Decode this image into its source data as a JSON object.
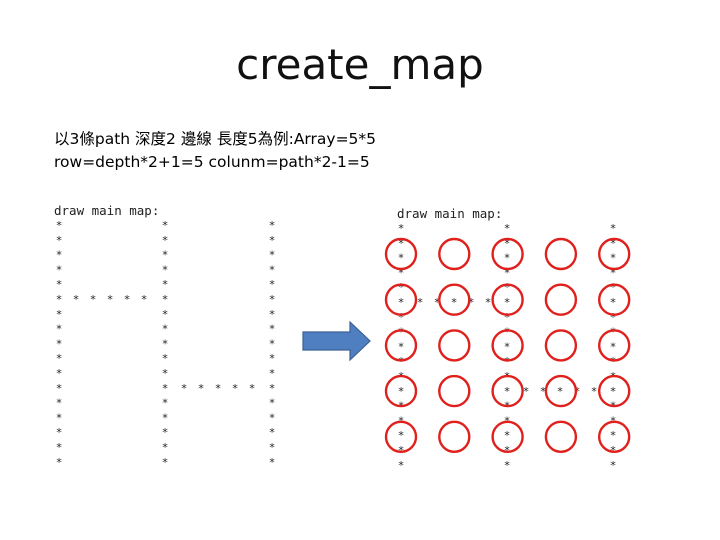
{
  "slide": {
    "title": "create_map",
    "description_line1": "以3條path 深度2 邊線 長度5為例:Array=5*5",
    "description_line2": "row=depth*2+1=5  colunm=path*2-1=5"
  },
  "left_map": {
    "title": "draw main map:",
    "rows": 17
  },
  "right_map": {
    "title": "draw main map:",
    "rows": 17,
    "grid_size": 5
  },
  "colors": {
    "arrow_fill": "#4f7fc0",
    "arrow_stroke": "#3a6296",
    "circle_stroke": "#e0201c"
  },
  "icons": {
    "arrow": "right-arrow-icon",
    "marker": "asterisk"
  }
}
